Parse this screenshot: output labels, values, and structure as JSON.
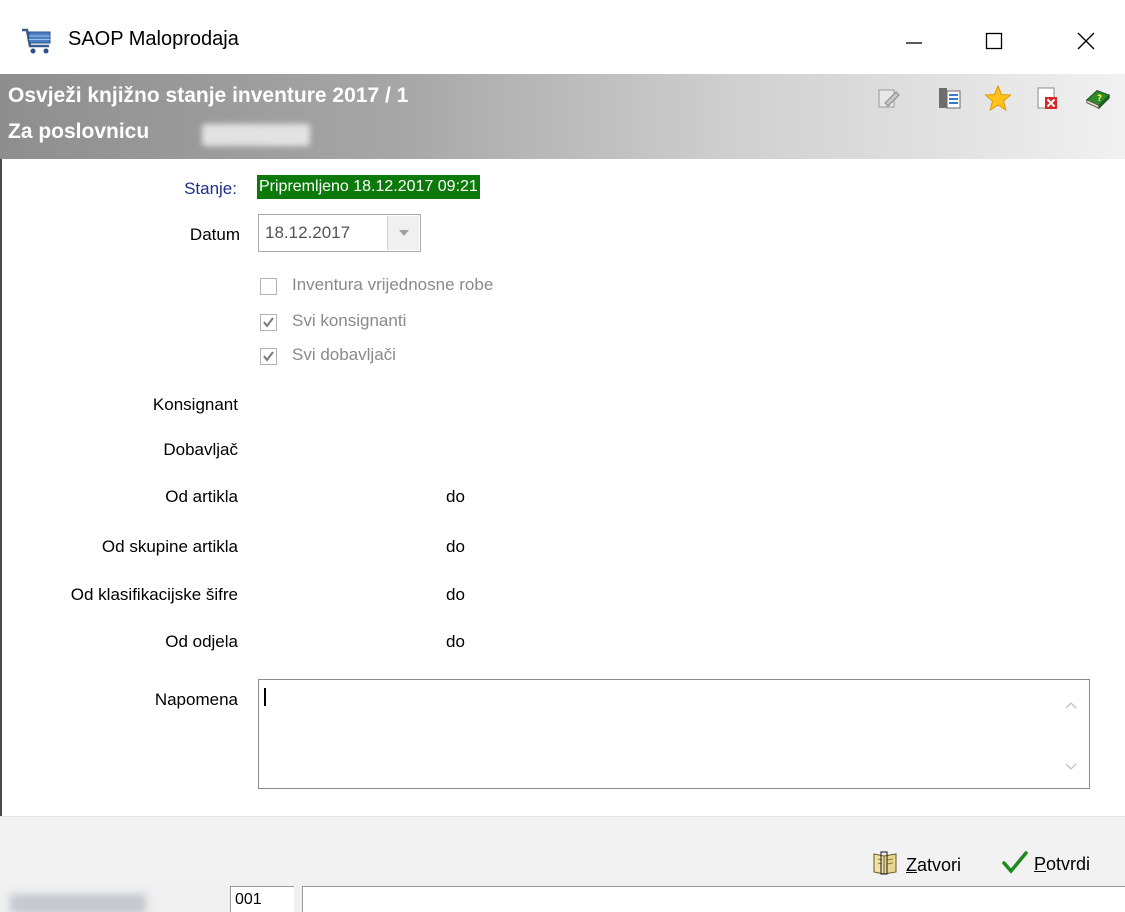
{
  "window": {
    "title": "SAOP Maloprodaja",
    "icon": "cart-icon"
  },
  "header": {
    "title": "Osvježi knjižno stanje inventure 2017 / 1",
    "subtitle": "Za poslovnicu",
    "toolbar_icons": [
      "edit-icon",
      "list-icon",
      "favorite-star-icon",
      "delete-icon",
      "help-book-icon"
    ]
  },
  "form": {
    "stanje_label": "Stanje:",
    "stanje_value": "Pripremljeno 18.12.2017 09:21",
    "datum_label": "Datum",
    "datum_value": "18.12.2017",
    "checkboxes": [
      {
        "label": "Inventura vrijednosne robe",
        "checked": false
      },
      {
        "label": "Svi konsignanti",
        "checked": true
      },
      {
        "label": "Svi dobavljači",
        "checked": true
      }
    ],
    "konsignant_label": "Konsignant",
    "dobavljac_label": "Dobavljač",
    "od_artikla_label": "Od artikla",
    "od_skupine_label": "Od skupine artikla",
    "od_klasifikacijske_label": "Od klasifikacijske šifre",
    "od_odjela_label": "Od odjela",
    "do_label": "do",
    "napomena_label": "Napomena",
    "napomena_value": ""
  },
  "buttons": {
    "zatvori_first": "Z",
    "zatvori_rest": "atvori",
    "potvrdi_first": "P",
    "potvrdi_rest": "otvrdi"
  },
  "statusbar": {
    "code": "001"
  },
  "colors": {
    "status_bg": "#0b7a0b",
    "stanje_label": "#1a2f8a"
  }
}
